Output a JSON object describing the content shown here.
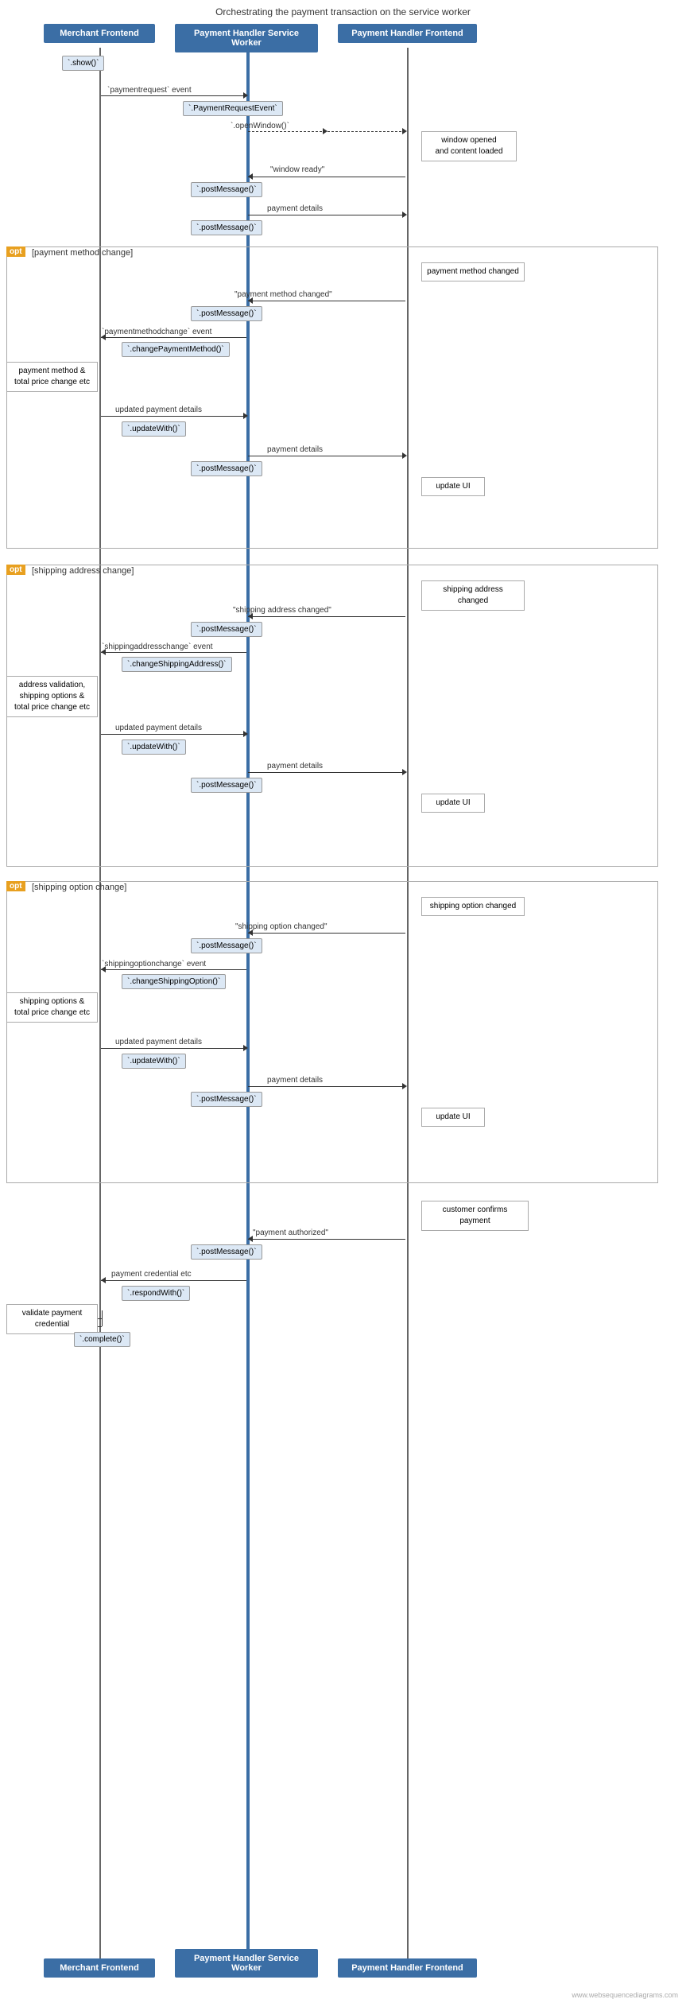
{
  "title": "Orchestrating the payment transaction on the service worker",
  "lifelines": {
    "merchant": "Merchant Frontend",
    "sw": "Payment Handler Service Worker",
    "frontend": "Payment Handler Frontend"
  },
  "watermark": "www.websequencediagrams.com",
  "sections": {
    "opt1_label": "opt",
    "opt1_condition": "[payment method change]",
    "opt2_label": "opt",
    "opt2_condition": "[shipping address change]",
    "opt3_label": "opt",
    "opt3_condition": "[shipping option change]"
  }
}
